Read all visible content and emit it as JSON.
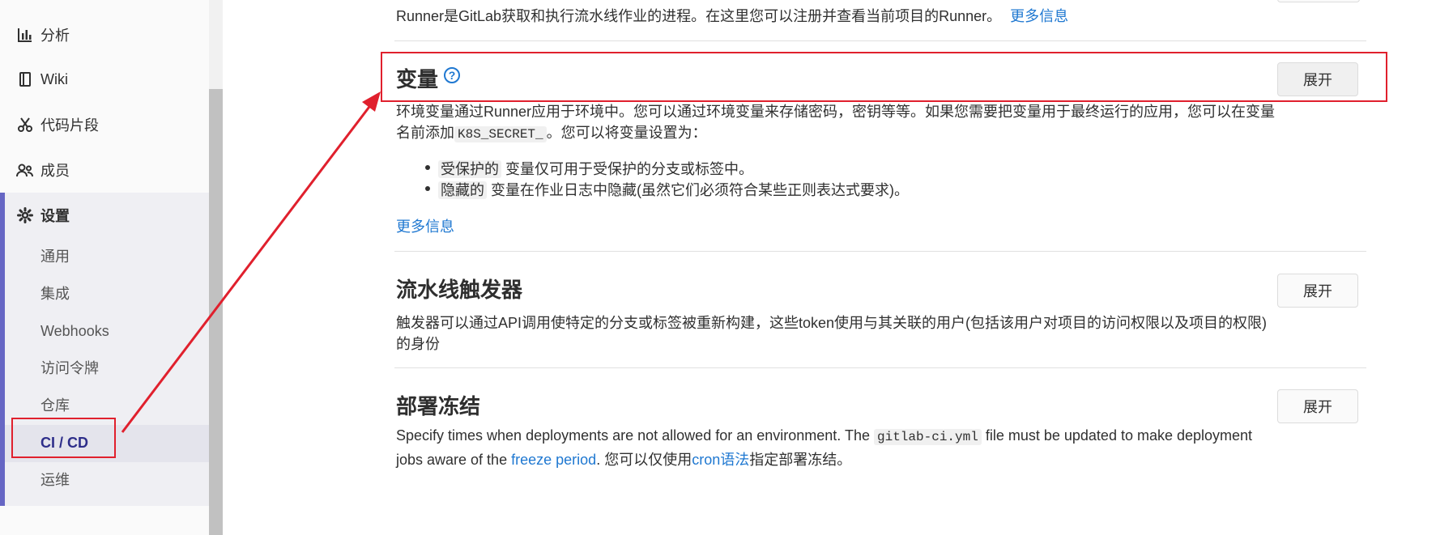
{
  "sidebar": {
    "items": [
      {
        "label": "分析",
        "icon": "chart-icon"
      },
      {
        "label": "Wiki",
        "icon": "book-icon"
      },
      {
        "label": "代码片段",
        "icon": "scissors-icon"
      },
      {
        "label": "成员",
        "icon": "users-icon"
      },
      {
        "label": "设置",
        "icon": "gear-icon"
      }
    ],
    "settings_sub": [
      "通用",
      "集成",
      "Webhooks",
      "访问令牌",
      "仓库",
      "CI / CD",
      "运维"
    ],
    "active_sub": "CI / CD"
  },
  "runner": {
    "description": "Runner是GitLab获取和执行流水线作业的进程。在这里您可以注册并查看当前项目的Runner。",
    "more_link": "更多信息"
  },
  "variables": {
    "title": "变量",
    "help_glyph": "?",
    "expand_label": "展开",
    "desc_line1": "环境变量通过Runner应用于环境中。您可以通过环境变量来存储密码，密钥等等。如果您需要把变量用于最终运行的应用，您可以在变量",
    "desc_line2_prefix": "名前添加",
    "desc_code": "K8S_SECRET_",
    "desc_line2_suffix": "。您可以将变量设置为：",
    "bullets": [
      {
        "tag": "受保护的",
        "text": "变量仅可用于受保护的分支或标签中。"
      },
      {
        "tag": "隐藏的",
        "text": "变量在作业日志中隐藏(虽然它们必须符合某些正则表达式要求)。"
      }
    ],
    "more_link": "更多信息"
  },
  "triggers": {
    "title": "流水线触发器",
    "expand_label": "展开",
    "desc_line1": "触发器可以通过API调用使特定的分支或标签被重新构建，这些token使用与其关联的用户(包括该用户对项目的访问权限以及项目的权限)",
    "desc_line2": "的身份"
  },
  "freeze": {
    "title": "部署冻结",
    "expand_label": "展开",
    "desc_part1": "Specify times when deployments are not allowed for an environment. The",
    "desc_code": "gitlab-ci.yml",
    "desc_part2": "file must be updated to make deployment",
    "desc_line2_prefix": "jobs aware of the",
    "freeze_link": "freeze period",
    "desc_line2_mid": ". 您可以仅使用",
    "cron_link": "cron语法",
    "desc_line2_suffix": "指定部署冻结。"
  },
  "colors": {
    "accent_link": "#1f78d1",
    "highlight_red": "#e0202d",
    "sidebar_active": "#6666c4"
  }
}
